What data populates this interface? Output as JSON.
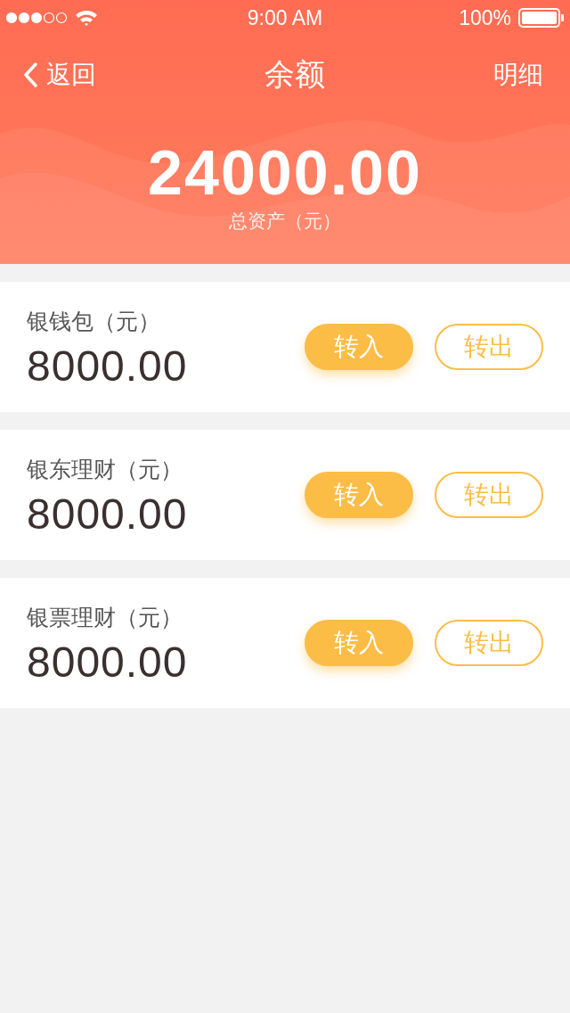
{
  "status_bar": {
    "time": "9:00 AM",
    "battery": "100%"
  },
  "nav": {
    "back": "返回",
    "title": "余额",
    "detail": "明细"
  },
  "summary": {
    "amount": "24000.00",
    "label": "总资产（元）"
  },
  "accounts": [
    {
      "name": "银钱包（元）",
      "amount": "8000.00",
      "transfer_in": "转入",
      "transfer_out": "转出"
    },
    {
      "name": "银东理财（元）",
      "amount": "8000.00",
      "transfer_in": "转入",
      "transfer_out": "转出"
    },
    {
      "name": "银票理财（元）",
      "amount": "8000.00",
      "transfer_in": "转入",
      "transfer_out": "转出"
    }
  ]
}
